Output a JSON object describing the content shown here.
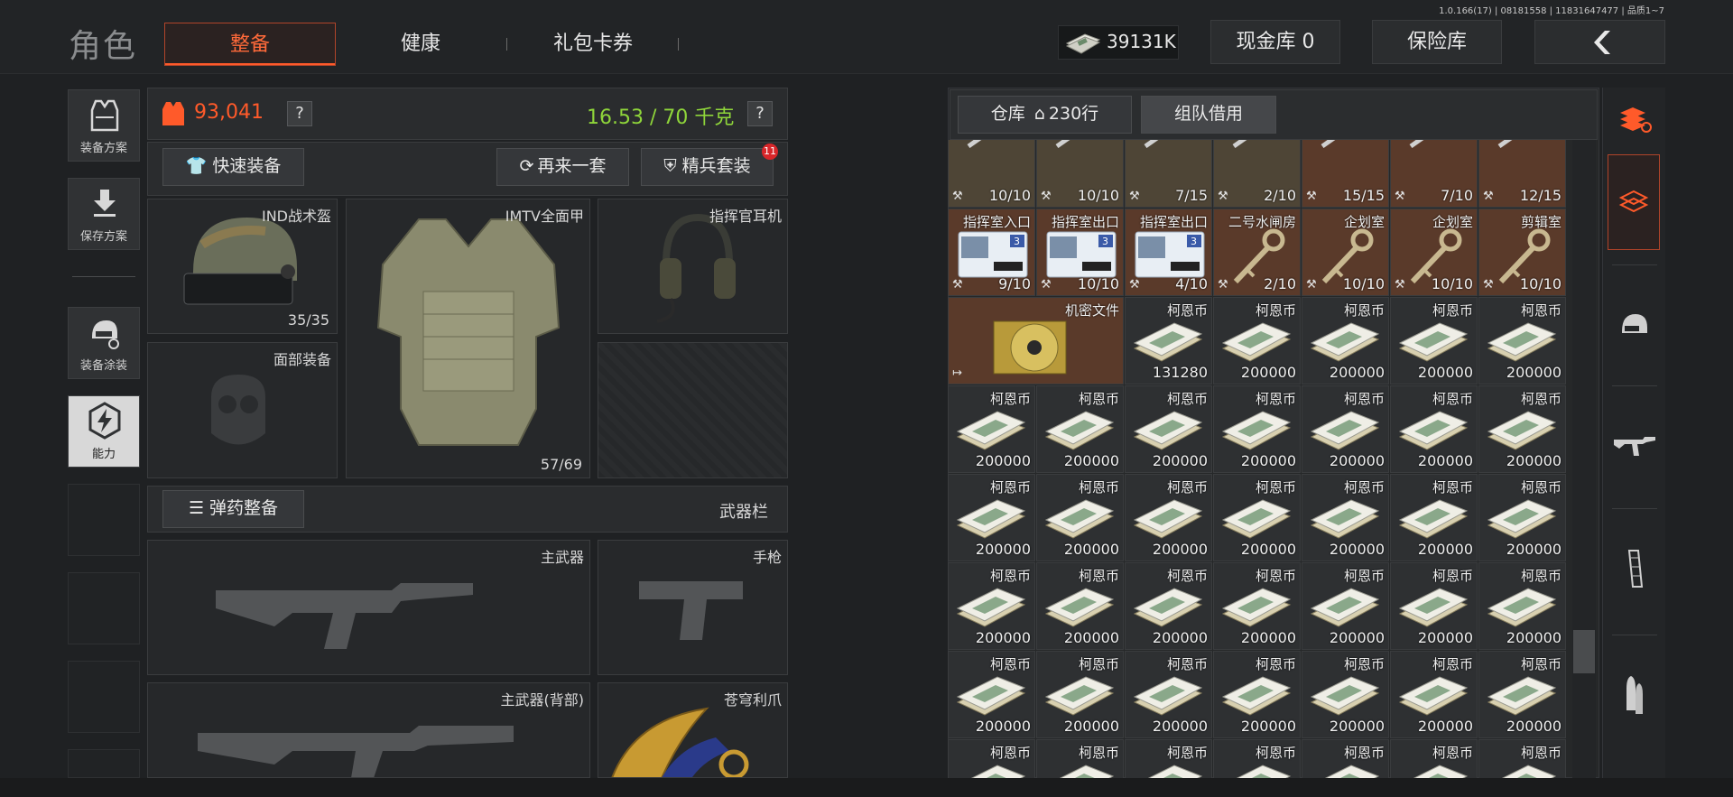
{
  "header": {
    "title": "角色",
    "tabs": [
      {
        "label": "整备",
        "active": true
      },
      {
        "label": "健康",
        "active": false
      },
      {
        "label": "礼包卡券",
        "active": false
      }
    ],
    "version": "1.0.166(17) | 08181558 | 11831647477 | 品质1~7",
    "currency_value": "39131K",
    "cash_vault_label": "现金库 0",
    "insurance_label": "保险库",
    "back_icon": "chevron-left-icon"
  },
  "sidebar": {
    "items": [
      {
        "label": "装备方案",
        "icon": "vest-icon"
      },
      {
        "label": "保存方案",
        "icon": "download-icon"
      },
      {
        "label": "装备涂装",
        "icon": "helmet-paint-icon"
      },
      {
        "label": "能力",
        "icon": "ability-icon",
        "active": true
      }
    ]
  },
  "equipment": {
    "armor_value": "93,041",
    "weight": "16.53 / 70 千克",
    "help": "?",
    "quick_equip_label": "快速装备",
    "again_label": "再来一套",
    "elite_label": "精兵套装",
    "elite_badge": "11",
    "slots": {
      "helmet": {
        "label": "IND战术盔",
        "count": "35/35"
      },
      "armor": {
        "label": "IMTV全面甲",
        "count": "57/69"
      },
      "headset": {
        "label": "指挥官耳机"
      },
      "face": {
        "label": "面部装备"
      }
    },
    "ammo_label": "弹药整备",
    "weapon_bar_label": "武器栏",
    "weapons": {
      "primary": "主武器",
      "pistol": "手枪",
      "primary_back": "主武器(背部)",
      "melee": "苍穹利爪"
    }
  },
  "inventory": {
    "warehouse_label": "仓库",
    "warehouse_rows": "230行",
    "team_borrow_label": "组队借用",
    "colors": {
      "brown": "#5a3a2a",
      "olive": "#4e4536",
      "default": "#2e3032"
    },
    "row0_counts": [
      "10/10",
      "10/10",
      "7/15",
      "2/10",
      "15/15",
      "7/10",
      "12/15"
    ],
    "row1": [
      {
        "name": "指挥室入口",
        "count": "9/10"
      },
      {
        "name": "指挥室出口",
        "count": "10/10"
      },
      {
        "name": "指挥室出口",
        "count": "4/10"
      },
      {
        "name": "二号水闸房",
        "count": "2/10"
      },
      {
        "name": "企划室",
        "count": "10/10"
      },
      {
        "name": "企划室",
        "count": "10/10"
      },
      {
        "name": "剪辑室",
        "count": "10/10"
      }
    ],
    "classified_name": "机密文件",
    "coin_name": "柯恩币",
    "coin_first_count": "131280",
    "coin_count": "200000"
  },
  "categories": [
    "stack-icon",
    "cube-stack-icon",
    "helmet-icon",
    "rifle-icon",
    "magazine-icon",
    "bullets-icon"
  ]
}
